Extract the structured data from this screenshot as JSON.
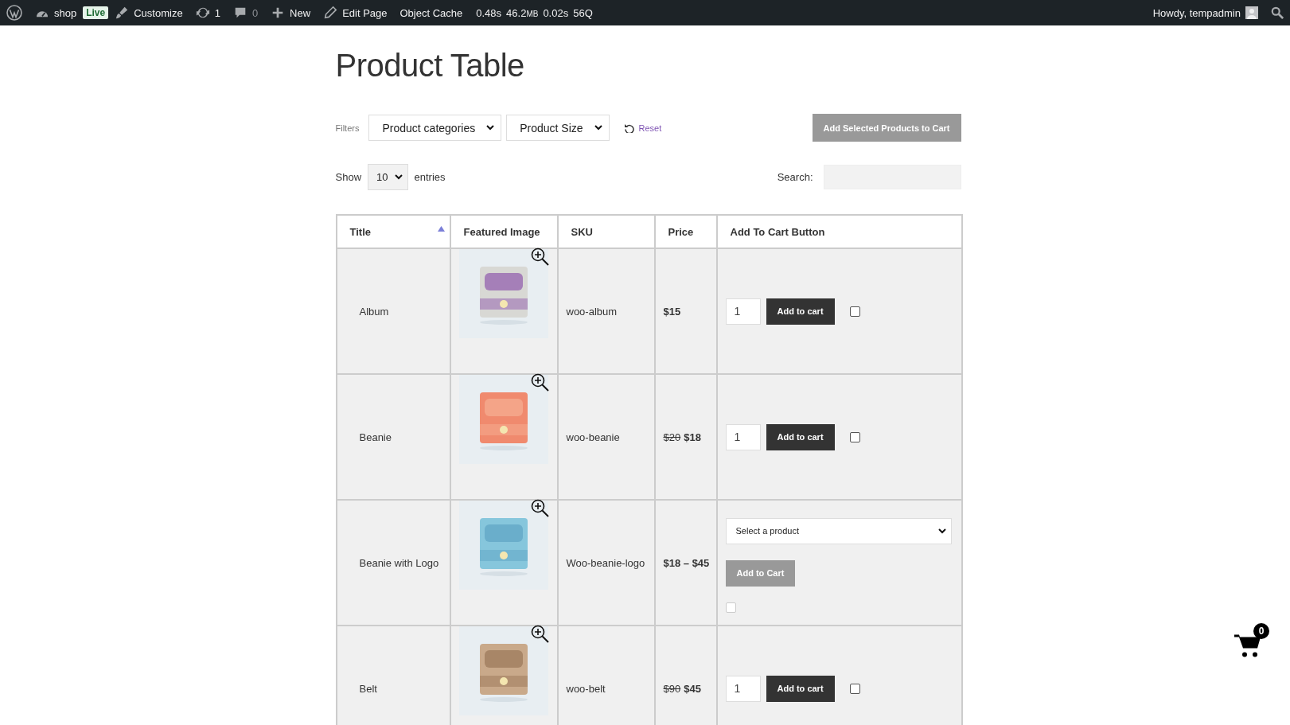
{
  "admin_bar": {
    "site": "shop",
    "badge": "Live",
    "items": [
      {
        "kind": "customize",
        "label": "Customize"
      },
      {
        "kind": "updates",
        "label": "1"
      },
      {
        "kind": "comments",
        "label": "0"
      },
      {
        "kind": "new",
        "label": "New"
      },
      {
        "kind": "edit",
        "label": "Edit Page"
      },
      {
        "kind": "plain",
        "label": "Object Cache"
      }
    ],
    "stats": [
      {
        "value": "0.48s"
      },
      {
        "value": "46.2",
        "unit": "MB"
      },
      {
        "value": "0.02s"
      },
      {
        "value": "56Q"
      }
    ],
    "greeting": "Howdy, tempadmin"
  },
  "page_title": "Product Table",
  "filters": {
    "label": "Filters",
    "selects": [
      "Product categories",
      "Product Size"
    ],
    "reset": "Reset",
    "add_selected": "Add Selected Products to Cart"
  },
  "length": {
    "show": "Show",
    "value": "10",
    "entries": "entries"
  },
  "search": {
    "label": "Search:"
  },
  "table": {
    "columns": [
      {
        "label": "Title",
        "sorted": true
      },
      {
        "label": "Featured Image",
        "sorted": false
      },
      {
        "label": "SKU",
        "sorted": false
      },
      {
        "label": "Price",
        "sorted": false
      },
      {
        "label": "Add To Cart Button",
        "sorted": false
      }
    ],
    "rows": [
      {
        "title": "Album",
        "sku": "woo-album",
        "price": "$15",
        "kind": "simple",
        "quantity": "1",
        "button": "Add to cart",
        "checked": false
      },
      {
        "title": "Beanie",
        "sku": "woo-beanie",
        "old_price": "$20",
        "price": "$18",
        "kind": "simple",
        "quantity": "1",
        "button": "Add to cart",
        "checked": false
      },
      {
        "title": "Beanie with Logo",
        "sku": "Woo-beanie-logo",
        "price": "$18 – $45",
        "kind": "variable",
        "placeholder": "Select a product",
        "button": "Add to Cart",
        "disabled": true,
        "checked": false
      },
      {
        "title": "Belt",
        "sku": "woo-belt",
        "old_price": "$90",
        "price": "$45",
        "kind": "simple",
        "quantity": "1",
        "button": "Add to cart",
        "checked": false
      }
    ]
  },
  "mini_cart": {
    "count": "0"
  }
}
